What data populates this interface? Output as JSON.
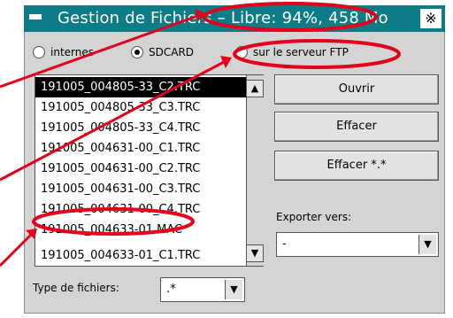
{
  "window": {
    "title": "Gestion de Fichiers – Libre: 94%, 458 Mo",
    "close_glyph": "※"
  },
  "storage_options": [
    {
      "label": "internes",
      "checked": false
    },
    {
      "label": "SDCARD",
      "checked": true
    },
    {
      "label": "sur le serveur FTP",
      "checked": false
    }
  ],
  "files": [
    {
      "name": "191005_004805-33_C2.TRC",
      "selected": true
    },
    {
      "name": "191005_004805-33_C3.TRC",
      "selected": false
    },
    {
      "name": "191005_004805-33_C4.TRC",
      "selected": false
    },
    {
      "name": "191005_004631-00_C1.TRC",
      "selected": false
    },
    {
      "name": "191005_004631-00_C2.TRC",
      "selected": false
    },
    {
      "name": "191005_004631-00_C3.TRC",
      "selected": false
    },
    {
      "name": "191005_004631-00_C4.TRC",
      "selected": false
    },
    {
      "name": "191005_004633-01.MAC",
      "selected": false
    },
    {
      "name": "191005_004633-01_C1.TRC",
      "selected": false
    }
  ],
  "buttons": {
    "open": "Ouvrir",
    "delete": "Effacer",
    "delete_all": "Effacer *.*"
  },
  "export": {
    "label": "Exporter vers:",
    "value": "-"
  },
  "filter": {
    "label": "Type de fichiers:",
    "value": ".*"
  },
  "colors": {
    "titlebar": "#0c7d86",
    "annotation": "#e3001b"
  },
  "icons": {
    "scroll_up": "▲",
    "scroll_down": "▼",
    "dropdown": "▼"
  }
}
